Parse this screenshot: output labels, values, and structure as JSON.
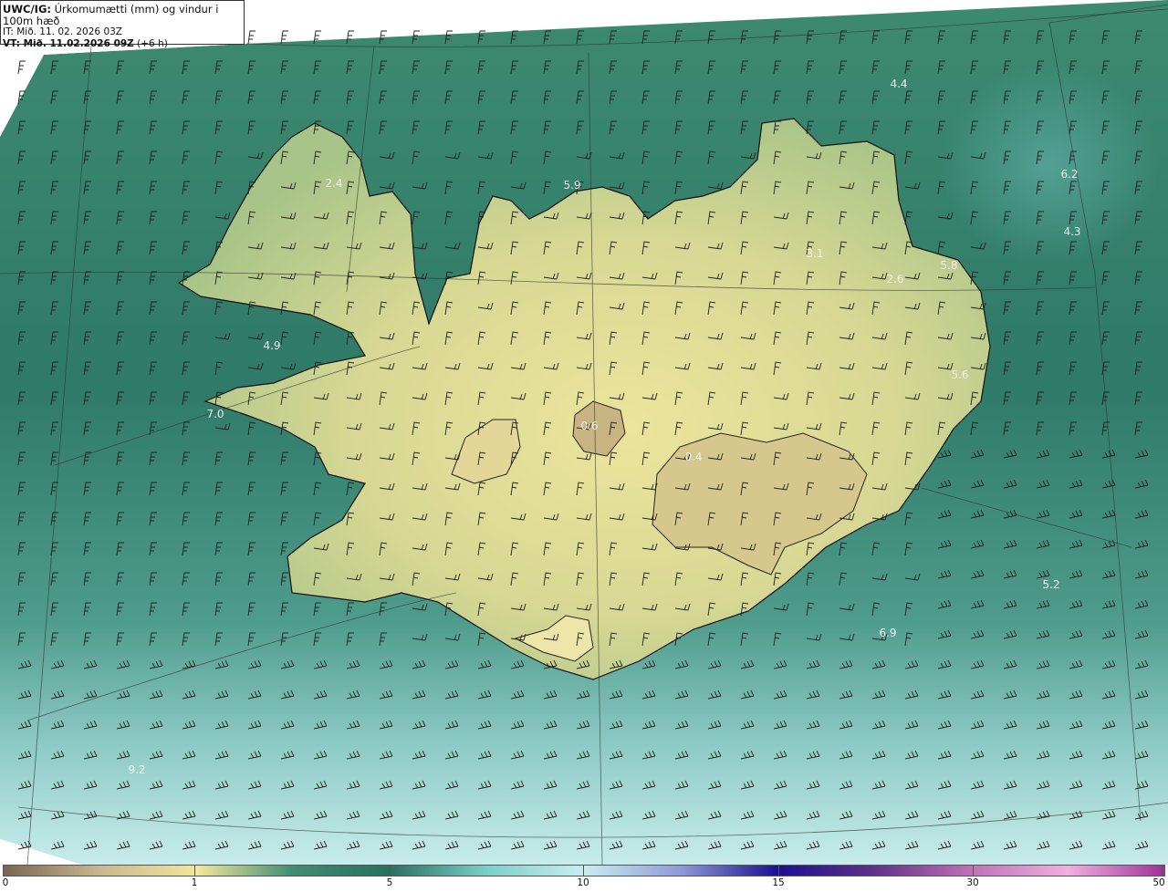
{
  "header": {
    "model": "UWC/IG:",
    "title": "Úrkomumætti (mm) og vindur i 100m hæð",
    "it_line": "IT: Mið. 11. 02. 2026 03Z",
    "vt_prefix": "VT: ",
    "vt_value": "Mið. 11.02.2026 09Z",
    "vt_suffix": " (+6 h)"
  },
  "map_values": [
    {
      "text": "4.4",
      "color": "#e8f2e8"
    },
    {
      "text": "6.2",
      "color": "#e8f2e8"
    },
    {
      "text": "4.3",
      "color": "#e8f2e8"
    },
    {
      "text": "2.4",
      "color": "#eeeeee"
    },
    {
      "text": "5.9",
      "color": "#eeeeee"
    },
    {
      "text": "3.1",
      "color": "#f4f4e4"
    },
    {
      "text": "2.6",
      "color": "#f4f4e4"
    },
    {
      "text": "5.8",
      "color": "#eeeeee"
    },
    {
      "text": "4.9",
      "color": "#eeeeee"
    },
    {
      "text": "5.6",
      "color": "#eeeeee"
    },
    {
      "text": "7.0",
      "color": "#eeeeee"
    },
    {
      "text": "0.6",
      "color": "#eeeeee"
    },
    {
      "text": "0.4",
      "color": "#eeeeee"
    },
    {
      "text": "5.2",
      "color": "#f0f8f8"
    },
    {
      "text": "6.9",
      "color": "#f0f8f8"
    },
    {
      "text": "9.2",
      "color": "#f0f8f8"
    }
  ],
  "colorbar": {
    "ticks": [
      "0",
      "1",
      "5",
      "10",
      "15",
      "30",
      "50"
    ],
    "colors": [
      "#7a6650",
      "#c8b890",
      "#f0e89a",
      "#3f8c72",
      "#2a7060",
      "#7ccfc9",
      "#c8eef0",
      "#8c9cd8",
      "#1a1090",
      "#60308a",
      "#c070b8",
      "#f0b0e0",
      "#a0309a"
    ]
  },
  "style": {
    "land_colors": [
      "#e8e09a",
      "#c8d48a",
      "#a0c488"
    ],
    "sea_colors": [
      "#3f8c72",
      "#2f7c68",
      "#5fa89a",
      "#a8dcd8"
    ],
    "coast_color": "#111111"
  }
}
